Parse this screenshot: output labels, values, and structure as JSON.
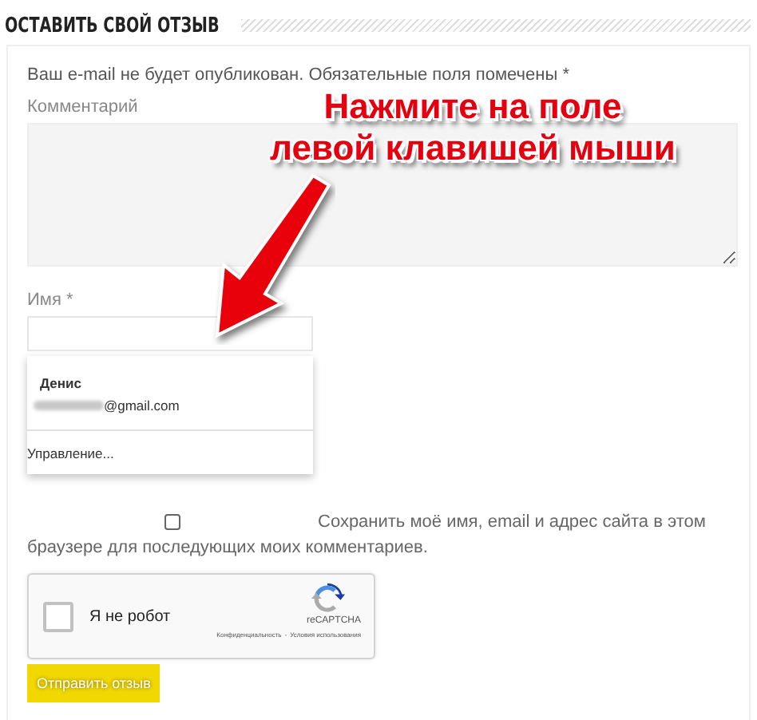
{
  "heading": "ОСТАВИТЬ СВОЙ ОТЗЫВ",
  "notice": "Ваш e-mail не будет опубликован. Обязательные поля помечены *",
  "comment_label": "Комментарий",
  "name_label": "Имя *",
  "autocomplete": {
    "name": "Денис",
    "email_suffix": "@gmail.com",
    "manage": "Управление..."
  },
  "save_checkbox": {
    "label_lines": [
      "Сохранить моё имя, email и адрес сайта в этом",
      "браузере для последующих моих комментариев."
    ],
    "checked": false
  },
  "captcha": {
    "label": "Я не робот",
    "checked": false,
    "brand": "reCAPTCHA",
    "links": [
      "Конфиденциальность",
      "Условия использования"
    ],
    "separator": "-"
  },
  "submit": "Отправить отзыв",
  "annotation": {
    "lines": [
      "Нажмите на поле",
      "левой клавишей мыши"
    ]
  }
}
